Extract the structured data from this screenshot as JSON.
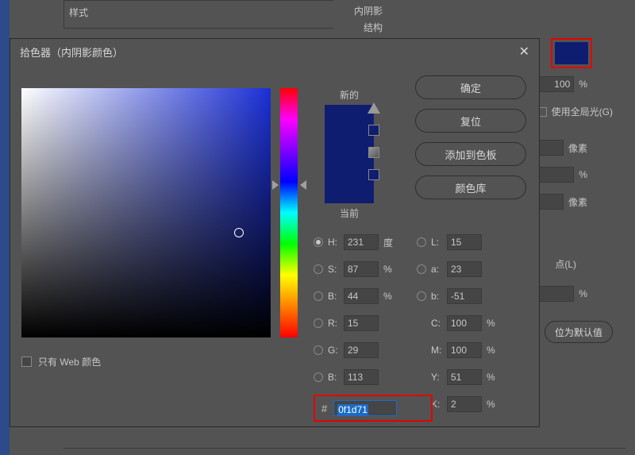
{
  "bg": {
    "style_label": "样式",
    "section_title": "内阴影",
    "struct_label": "结构",
    "use_global_light": "使用全局光(G)",
    "px_unit": "像素",
    "pct_unit": "%",
    "val100": "100",
    "points_label": "点(L)",
    "default_btn": "位为默认值"
  },
  "dialog": {
    "title": "拾色器（内阴影颜色）",
    "new_label": "新的",
    "current_label": "当前",
    "web_only": "只有 Web 颜色",
    "buttons": {
      "ok": "确定",
      "reset": "复位",
      "add_swatch": "添加到色板",
      "color_lib": "颜色库"
    },
    "fields": {
      "H": {
        "label": "H:",
        "value": "231",
        "unit": "度"
      },
      "S": {
        "label": "S:",
        "value": "87",
        "unit": "%"
      },
      "B": {
        "label": "B:",
        "value": "44",
        "unit": "%"
      },
      "R": {
        "label": "R:",
        "value": "15"
      },
      "G": {
        "label": "G:",
        "value": "29"
      },
      "Bb": {
        "label": "B:",
        "value": "113"
      },
      "L": {
        "label": "L:",
        "value": "15"
      },
      "a": {
        "label": "a:",
        "value": "23"
      },
      "b": {
        "label": "b:",
        "value": "-51"
      },
      "C": {
        "label": "C:",
        "value": "100",
        "unit": "%"
      },
      "M": {
        "label": "M:",
        "value": "100",
        "unit": "%"
      },
      "Y": {
        "label": "Y:",
        "value": "51",
        "unit": "%"
      },
      "K": {
        "label": "K:",
        "value": "2",
        "unit": "%"
      }
    },
    "hex": {
      "label": "#",
      "value": "0f1d71"
    }
  },
  "colors": {
    "swatch": "#0f1d71"
  }
}
